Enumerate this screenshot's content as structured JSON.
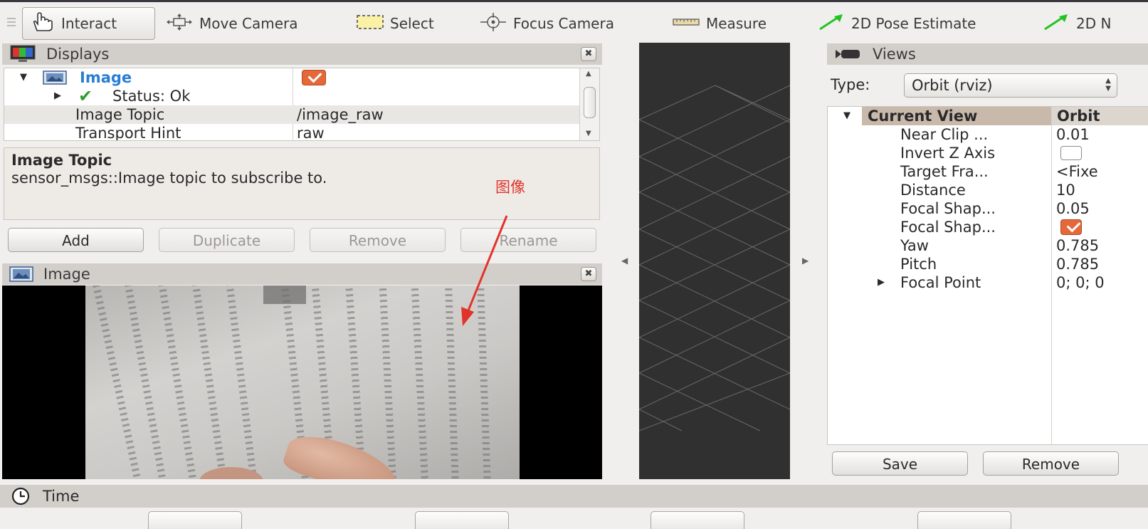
{
  "colors": {
    "accent_checkbox": "#e5683a",
    "selected_item_text": "#2a7fd4",
    "status_ok_check": "#2e9d2e",
    "annotation_red": "#e2332b",
    "pose_arrow_green": "#22c322",
    "render_bg": "#303030"
  },
  "toolbar": {
    "tools": [
      {
        "label": "Interact",
        "icon": "hand-pointer-icon"
      },
      {
        "label": "Move Camera",
        "icon": "move-camera-icon"
      },
      {
        "label": "Select",
        "icon": "selection-box-icon"
      },
      {
        "label": "Focus Camera",
        "icon": "focus-crosshair-icon"
      },
      {
        "label": "Measure",
        "icon": "ruler-icon"
      },
      {
        "label": "2D Pose Estimate",
        "icon": "green-arrow-icon"
      },
      {
        "label": "2D N",
        "icon": "green-arrow-icon"
      }
    ]
  },
  "displays": {
    "title": "Displays",
    "close": "✖",
    "tree": {
      "image_item": "Image",
      "status": "Status: Ok",
      "props": [
        {
          "name": "Image Topic",
          "value": "/image_raw"
        },
        {
          "name": "Transport Hint",
          "value": "raw"
        }
      ]
    },
    "description": {
      "title": "Image Topic",
      "text": "sensor_msgs::Image topic to subscribe to."
    },
    "buttons": {
      "add": "Add",
      "duplicate": "Duplicate",
      "remove": "Remove",
      "rename": "Rename"
    }
  },
  "image_panel": {
    "title": "Image",
    "close": "✖"
  },
  "annotation": {
    "label": "图像"
  },
  "views": {
    "title": "Views",
    "type_label": "Type:",
    "type_value": "Orbit (rviz)",
    "header": {
      "name": "Current View",
      "value": "Orbit"
    },
    "rows": [
      {
        "name": "Near Clip ...",
        "value": "0.01"
      },
      {
        "name": "Invert Z Axis",
        "value": ""
      },
      {
        "name": "Target Fra...",
        "value": "<Fixe"
      },
      {
        "name": "Distance",
        "value": "10"
      },
      {
        "name": "Focal Shap...",
        "value": "0.05"
      },
      {
        "name": "Focal Shap...",
        "value": ""
      },
      {
        "name": "Yaw",
        "value": "0.785"
      },
      {
        "name": "Pitch",
        "value": "0.785"
      },
      {
        "name": "Focal Point",
        "value": "0; 0; 0"
      }
    ],
    "buttons": {
      "save": "Save",
      "remove": "Remove"
    }
  },
  "time": {
    "title": "Time"
  }
}
